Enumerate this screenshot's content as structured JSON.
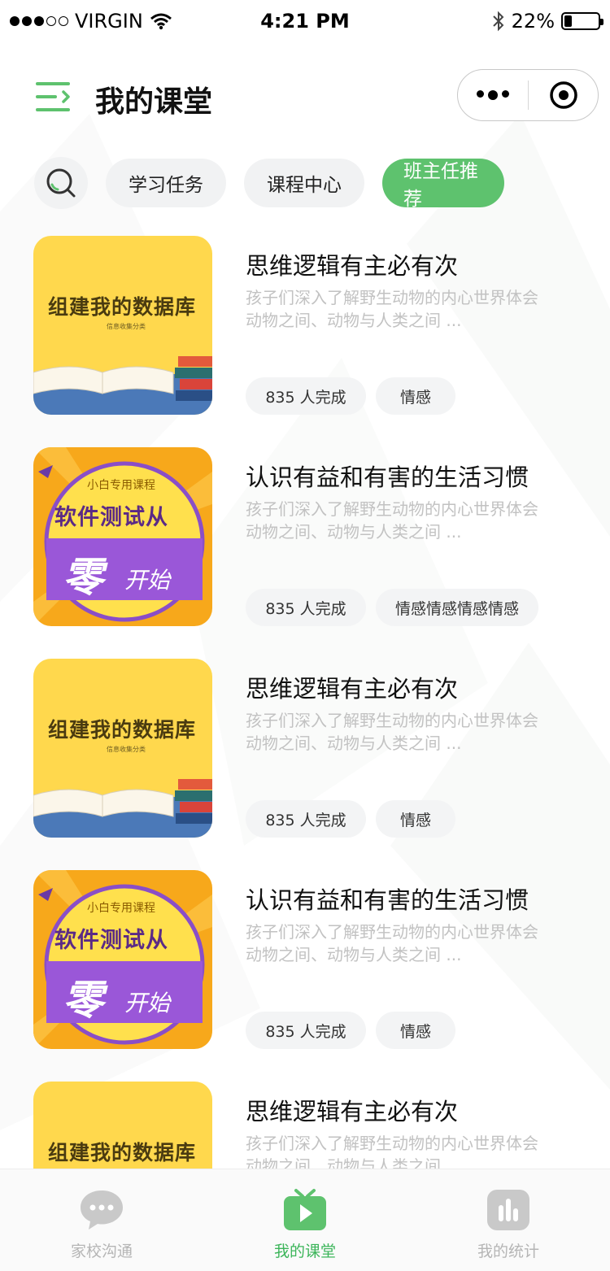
{
  "status_bar": {
    "carrier": "VIRGIN",
    "time": "4:21 PM",
    "battery": "22%",
    "battery_level": 0.22
  },
  "header": {
    "title": "我的课堂"
  },
  "tabs": {
    "items": [
      {
        "label": "学习任务",
        "active": false
      },
      {
        "label": "课程中心",
        "active": false
      },
      {
        "label": "班主任推荐",
        "active": true
      }
    ]
  },
  "thumbnails": {
    "database": {
      "title": "组建我的数据库",
      "subtitle": "信息收集分类"
    },
    "software": {
      "small": "小白专用课程",
      "big": "软件测试从",
      "zero": "零",
      "start": "开始"
    }
  },
  "courses": [
    {
      "title": "思维逻辑有主必有次",
      "desc": "孩子们深入了解野生动物的内心世界体会动物之间、动物与人类之间 ...",
      "completed": "835 人完成",
      "tag": "情感",
      "thumb": "database"
    },
    {
      "title": "认识有益和有害的生活习惯",
      "desc": "孩子们深入了解野生动物的内心世界体会动物之间、动物与人类之间 ...",
      "completed": "835 人完成",
      "tag": "情感情感情感情感",
      "thumb": "software"
    },
    {
      "title": "思维逻辑有主必有次",
      "desc": "孩子们深入了解野生动物的内心世界体会动物之间、动物与人类之间 ...",
      "completed": "835 人完成",
      "tag": "情感",
      "thumb": "database"
    },
    {
      "title": "认识有益和有害的生活习惯",
      "desc": "孩子们深入了解野生动物的内心世界体会动物之间、动物与人类之间 ...",
      "completed": "835 人完成",
      "tag": "情感",
      "thumb": "software"
    },
    {
      "title": "思维逻辑有主必有次",
      "desc": "孩子们深入了解野生动物的内心世界体会动物之间、动物与人类之间 ...",
      "completed": "",
      "tag": "",
      "thumb": "database"
    }
  ],
  "tabbar": {
    "items": [
      {
        "label": "家校沟通",
        "icon": "chat-bubble-icon",
        "active": false
      },
      {
        "label": "我的课堂",
        "icon": "tv-play-icon",
        "active": true
      },
      {
        "label": "我的统计",
        "icon": "bar-chart-icon",
        "active": false
      }
    ]
  },
  "colors": {
    "accent": "#5ec26e",
    "tab_active_text": "#3cb55a",
    "desc_text": "#c2c2c2"
  }
}
